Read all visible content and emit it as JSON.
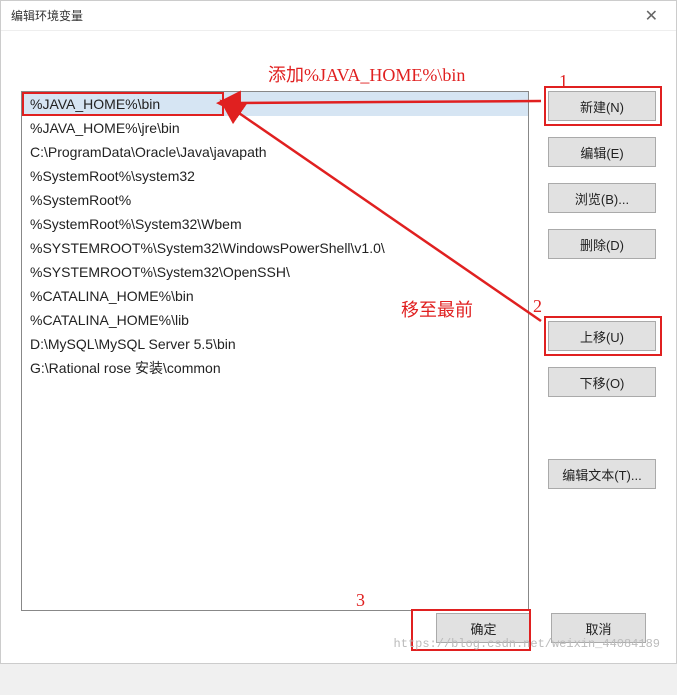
{
  "titlebar": {
    "title": "编辑环境变量"
  },
  "paths": [
    "%JAVA_HOME%\\bin",
    "%JAVA_HOME%\\jre\\bin",
    "C:\\ProgramData\\Oracle\\Java\\javapath",
    "%SystemRoot%\\system32",
    "%SystemRoot%",
    "%SystemRoot%\\System32\\Wbem",
    "%SYSTEMROOT%\\System32\\WindowsPowerShell\\v1.0\\",
    "%SYSTEMROOT%\\System32\\OpenSSH\\",
    "%CATALINA_HOME%\\bin",
    "%CATALINA_HOME%\\lib",
    "D:\\MySQL\\MySQL Server 5.5\\bin",
    "G:\\Rational rose 安装\\common"
  ],
  "buttons": {
    "new": "新建(N)",
    "edit": "编辑(E)",
    "browse": "浏览(B)...",
    "delete": "删除(D)",
    "moveup": "上移(U)",
    "movedown": "下移(O)",
    "edittext": "编辑文本(T)...",
    "ok": "确定",
    "cancel": "取消"
  },
  "annotations": {
    "add": "添加%JAVA_HOME%\\bin",
    "movefront": "移至最前",
    "n1": "1",
    "n2": "2",
    "n3": "3"
  },
  "watermark": "https://blog.csdn.net/weixin_44084189"
}
